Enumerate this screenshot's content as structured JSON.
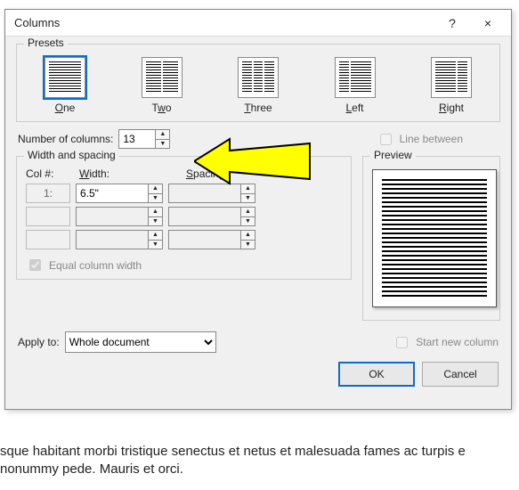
{
  "page_bg": {
    "line_top": "",
    "line_bottom1": "sque habitant morbi tristique senectus et netus et malesuada fames ac turpis e",
    "line_bottom2": " nonummy pede. Mauris et orci."
  },
  "dialog": {
    "title": "Columns",
    "help_icon": "?",
    "close_icon": "×"
  },
  "presets": {
    "label": "Presets",
    "items": [
      "One",
      "Two",
      "Three",
      "Left",
      "Right"
    ],
    "selected_index": 0
  },
  "num_columns": {
    "label": "Number of columns:",
    "value": "13"
  },
  "line_between": {
    "label": "Line between",
    "checked": false
  },
  "width_spacing": {
    "group_label": "Width and spacing",
    "col_header": "Col #:",
    "width_header": "Width:",
    "spacing_header": "Spacing:",
    "rows": [
      {
        "col": "1:",
        "width": "6.5\"",
        "spacing": ""
      },
      {
        "col": "",
        "width": "",
        "spacing": ""
      },
      {
        "col": "",
        "width": "",
        "spacing": ""
      }
    ],
    "equal_label": "Equal column width",
    "equal_checked": true
  },
  "preview": {
    "label": "Preview"
  },
  "apply_to": {
    "label": "Apply to:",
    "value": "Whole document"
  },
  "start_new": {
    "label": "Start new column",
    "checked": false
  },
  "buttons": {
    "ok": "OK",
    "cancel": "Cancel"
  }
}
